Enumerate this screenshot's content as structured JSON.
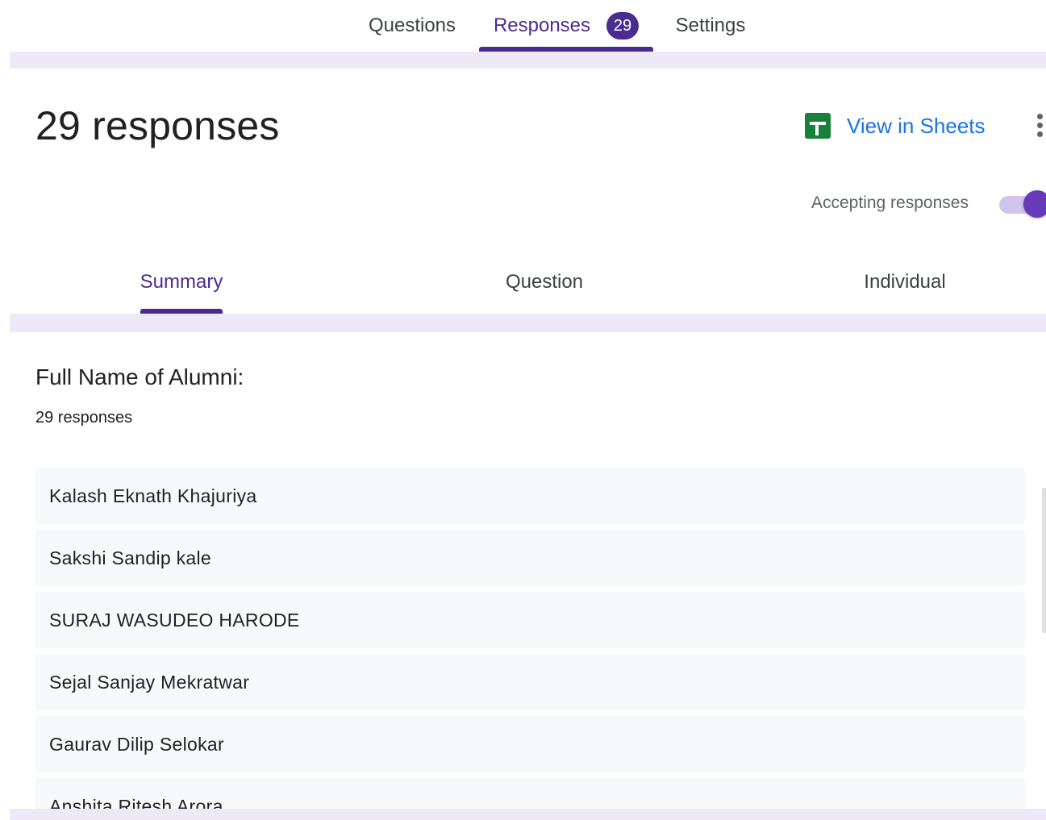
{
  "top_tabs": {
    "questions": "Questions",
    "responses": "Responses",
    "responses_badge": "29",
    "settings": "Settings"
  },
  "header": {
    "title": "29 responses",
    "view_in_sheets": "View in Sheets",
    "accepting_label": "Accepting responses",
    "accepting_on": true
  },
  "sub_tabs": {
    "summary": "Summary",
    "question": "Question",
    "individual": "Individual"
  },
  "question": {
    "title": "Full Name of Alumni:",
    "count": "29 responses",
    "responses": [
      "Kalash Eknath Khajuriya",
      "Sakshi Sandip kale",
      "SURAJ WASUDEO HARODE",
      "Sejal Sanjay Mekratwar",
      "Gaurav Dilip Selokar",
      "Anshita Ritesh Arora"
    ]
  },
  "colors": {
    "accent": "#4a2c91",
    "link": "#1a73e8",
    "sheets": "#188038",
    "strip": "#ede9f7"
  }
}
